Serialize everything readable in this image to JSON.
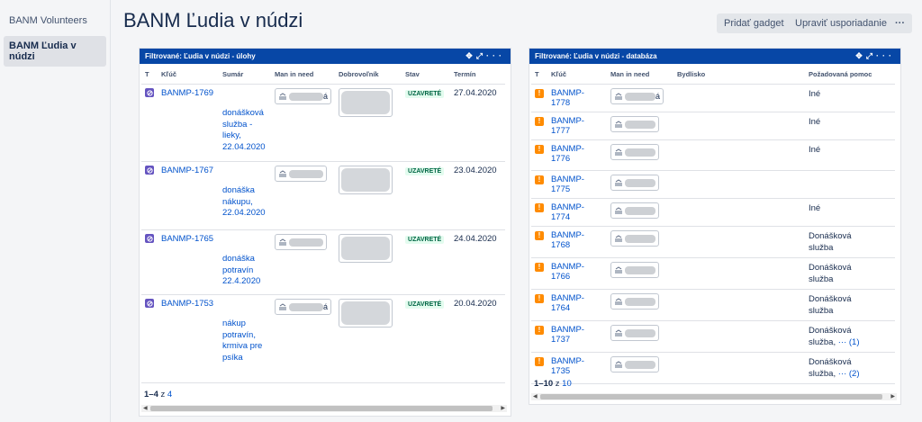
{
  "sidebar": {
    "items": [
      {
        "label": "BANM Volunteers"
      },
      {
        "label": "BANM Ľudia v núdzi"
      }
    ]
  },
  "page": {
    "title": "BANM Ľudia v núdzi",
    "add_gadget": "Pridať gadget",
    "edit_layout": "Upraviť usporiadanie",
    "more": "···"
  },
  "gadget_left": {
    "title": "Filtrované: Ľudia v núdzi - úlohy",
    "columns": [
      "T",
      "Kľúč",
      "Sumár",
      "Man in need",
      "Dobrovoľník",
      "Stav",
      "Termín"
    ],
    "rows": [
      {
        "key": "BANMP-1769",
        "summary": "donášková služba - lieky, 22.04.2020",
        "man_suffix": "á",
        "status": "UZAVRETÉ",
        "date": "27.04.2020"
      },
      {
        "key": "BANMP-1767",
        "summary": "donáška nákupu, 22.04.2020",
        "man_suffix": "",
        "status": "UZAVRETÉ",
        "date": "23.04.2020"
      },
      {
        "key": "BANMP-1765",
        "summary": "donáška potravín 22.4.2020",
        "man_suffix": "",
        "status": "UZAVRETÉ",
        "date": "24.04.2020"
      },
      {
        "key": "BANMP-1753",
        "summary": "nákup potravín, krmiva pre psíka",
        "man_suffix": "á",
        "status": "UZAVRETÉ",
        "date": "20.04.2020"
      }
    ],
    "pager": {
      "range": "1–4",
      "of": "z",
      "total": "4"
    }
  },
  "gadget_right": {
    "title": "Filtrované: Ľudia v núdzi - databáza",
    "columns": [
      "T",
      "Kľúč",
      "Man in need",
      "Bydlisko",
      "Požadovaná pomoc"
    ],
    "rows": [
      {
        "key": "BANMP-1778",
        "man_suffix": "á",
        "help": "Iné"
      },
      {
        "key": "BANMP-1777",
        "man_suffix": "",
        "help": "Iné"
      },
      {
        "key": "BANMP-1776",
        "man_suffix": "",
        "help": "Iné"
      },
      {
        "key": "BANMP-1775",
        "man_suffix": "",
        "help": ""
      },
      {
        "key": "BANMP-1774",
        "man_suffix": "",
        "help": "Iné"
      },
      {
        "key": "BANMP-1768",
        "man_suffix": "",
        "help": "Donášková služba"
      },
      {
        "key": "BANMP-1766",
        "man_suffix": "",
        "help": "Donášková služba"
      },
      {
        "key": "BANMP-1764",
        "man_suffix": "",
        "help": "Donášková služba"
      },
      {
        "key": "BANMP-1737",
        "man_suffix": "",
        "help": "Donášková služba,",
        "more": "··· (1)"
      },
      {
        "key": "BANMP-1735",
        "man_suffix": "",
        "help": "Donášková služba,",
        "more": "··· (2)"
      }
    ],
    "pager": {
      "range": "1–10",
      "of": "z",
      "total": "10"
    }
  },
  "colors": {
    "header_blue": "#0747a6",
    "link": "#0052cc",
    "status_green": "#006644",
    "orange": "#ff8b00",
    "purple": "#6554c0"
  }
}
